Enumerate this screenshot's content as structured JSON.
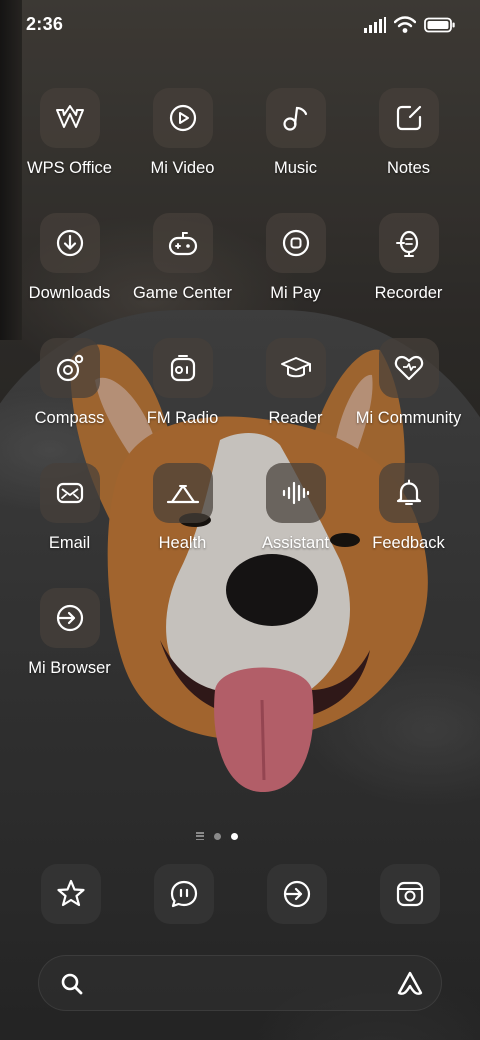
{
  "status_bar": {
    "time": "2:36",
    "icons": [
      "signal-icon",
      "wifi-icon",
      "battery-icon"
    ]
  },
  "apps": [
    {
      "label": "WPS Office",
      "icon": "wps-office-icon"
    },
    {
      "label": "Mi Video",
      "icon": "play-icon"
    },
    {
      "label": "Music",
      "icon": "music-note-icon"
    },
    {
      "label": "Notes",
      "icon": "notes-icon"
    },
    {
      "label": "Downloads",
      "icon": "download-icon"
    },
    {
      "label": "Game Center",
      "icon": "gamepad-icon"
    },
    {
      "label": "Mi Pay",
      "icon": "mi-pay-icon"
    },
    {
      "label": "Recorder",
      "icon": "microphone-icon"
    },
    {
      "label": "Compass",
      "icon": "compass-icon"
    },
    {
      "label": "FM Radio",
      "icon": "radio-icon"
    },
    {
      "label": "Reader",
      "icon": "graduation-cap-icon"
    },
    {
      "label": "Mi Community",
      "icon": "heart-icon"
    },
    {
      "label": "Email",
      "icon": "mail-icon"
    },
    {
      "label": "Health",
      "icon": "health-icon"
    },
    {
      "label": "Assistant",
      "icon": "voice-wave-icon"
    },
    {
      "label": "Feedback",
      "icon": "bell-icon"
    },
    {
      "label": "Mi Browser",
      "icon": "browser-arrow-icon"
    }
  ],
  "pages": {
    "count": 2,
    "active": 2
  },
  "dock": [
    {
      "icon": "star-icon"
    },
    {
      "icon": "message-bubble-icon"
    },
    {
      "icon": "browser-arrow-icon"
    },
    {
      "icon": "camera-icon"
    }
  ],
  "search_bar": {
    "left_icon": "search-icon",
    "right_icon": "ai-assistant-icon"
  },
  "colors": {
    "tile_bg": "#46403a",
    "text": "#ffffff",
    "dot_active": "#ffffff"
  }
}
